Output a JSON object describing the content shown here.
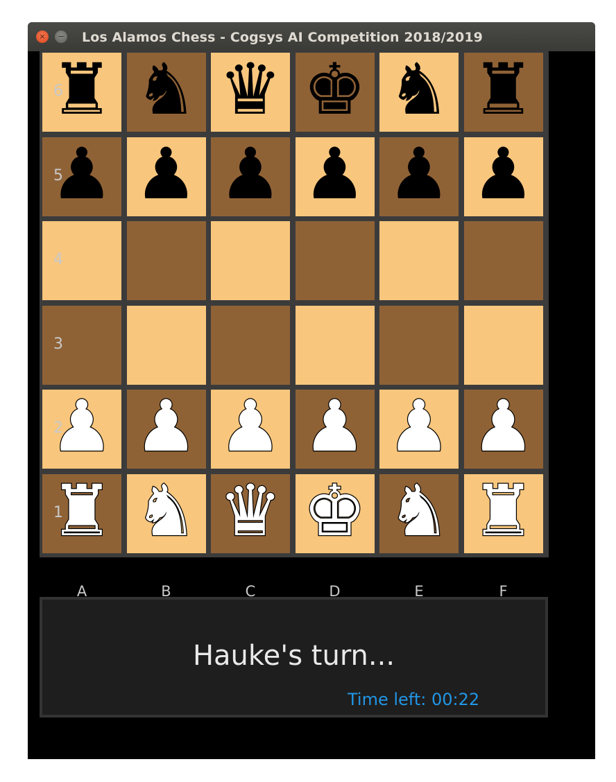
{
  "window": {
    "title": "Los Alamos Chess - Cogsys AI Competition 2018/2019",
    "close_glyph": "×",
    "minimize_glyph": "−"
  },
  "board": {
    "files": [
      "A",
      "B",
      "C",
      "D",
      "E",
      "F"
    ],
    "ranks": [
      "6",
      "5",
      "4",
      "3",
      "2",
      "1"
    ],
    "colors": {
      "light": "#f8c67d",
      "dark": "#8f6236",
      "grid": "#3b3b3b"
    },
    "rows": [
      [
        {
          "sq": "a6",
          "color": "light",
          "piece": "black-rook",
          "glyph": "♜",
          "side": "black"
        },
        {
          "sq": "b6",
          "color": "dark",
          "piece": "black-knight",
          "glyph": "♞",
          "side": "black"
        },
        {
          "sq": "c6",
          "color": "light",
          "piece": "black-queen",
          "glyph": "♛",
          "side": "black"
        },
        {
          "sq": "d6",
          "color": "dark",
          "piece": "black-king",
          "glyph": "♚",
          "side": "black"
        },
        {
          "sq": "e6",
          "color": "light",
          "piece": "black-knight",
          "glyph": "♞",
          "side": "black"
        },
        {
          "sq": "f6",
          "color": "dark",
          "piece": "black-rook",
          "glyph": "♜",
          "side": "black"
        }
      ],
      [
        {
          "sq": "a5",
          "color": "dark",
          "piece": "black-pawn",
          "glyph": "♟",
          "side": "black"
        },
        {
          "sq": "b5",
          "color": "light",
          "piece": "black-pawn",
          "glyph": "♟",
          "side": "black"
        },
        {
          "sq": "c5",
          "color": "dark",
          "piece": "black-pawn",
          "glyph": "♟",
          "side": "black"
        },
        {
          "sq": "d5",
          "color": "light",
          "piece": "black-pawn",
          "glyph": "♟",
          "side": "black"
        },
        {
          "sq": "e5",
          "color": "dark",
          "piece": "black-pawn",
          "glyph": "♟",
          "side": "black"
        },
        {
          "sq": "f5",
          "color": "light",
          "piece": "black-pawn",
          "glyph": "♟",
          "side": "black"
        }
      ],
      [
        {
          "sq": "a4",
          "color": "light",
          "piece": null
        },
        {
          "sq": "b4",
          "color": "dark",
          "piece": null
        },
        {
          "sq": "c4",
          "color": "light",
          "piece": null
        },
        {
          "sq": "d4",
          "color": "dark",
          "piece": null
        },
        {
          "sq": "e4",
          "color": "light",
          "piece": null
        },
        {
          "sq": "f4",
          "color": "dark",
          "piece": null
        }
      ],
      [
        {
          "sq": "a3",
          "color": "dark",
          "piece": null
        },
        {
          "sq": "b3",
          "color": "light",
          "piece": null
        },
        {
          "sq": "c3",
          "color": "dark",
          "piece": null
        },
        {
          "sq": "d3",
          "color": "light",
          "piece": null
        },
        {
          "sq": "e3",
          "color": "dark",
          "piece": null
        },
        {
          "sq": "f3",
          "color": "light",
          "piece": null
        }
      ],
      [
        {
          "sq": "a2",
          "color": "light",
          "piece": "white-pawn",
          "glyph": "♟",
          "side": "white"
        },
        {
          "sq": "b2",
          "color": "dark",
          "piece": "white-pawn",
          "glyph": "♟",
          "side": "white"
        },
        {
          "sq": "c2",
          "color": "light",
          "piece": "white-pawn",
          "glyph": "♟",
          "side": "white"
        },
        {
          "sq": "d2",
          "color": "dark",
          "piece": "white-pawn",
          "glyph": "♟",
          "side": "white"
        },
        {
          "sq": "e2",
          "color": "light",
          "piece": "white-pawn",
          "glyph": "♟",
          "side": "white"
        },
        {
          "sq": "f2",
          "color": "dark",
          "piece": "white-pawn",
          "glyph": "♟",
          "side": "white"
        }
      ],
      [
        {
          "sq": "a1",
          "color": "dark",
          "piece": "white-rook",
          "glyph": "♜",
          "side": "white"
        },
        {
          "sq": "b1",
          "color": "light",
          "piece": "white-knight",
          "glyph": "♞",
          "side": "white"
        },
        {
          "sq": "c1",
          "color": "dark",
          "piece": "white-queen",
          "glyph": "♛",
          "side": "white"
        },
        {
          "sq": "d1",
          "color": "light",
          "piece": "white-king",
          "glyph": "♚",
          "side": "white"
        },
        {
          "sq": "e1",
          "color": "dark",
          "piece": "white-knight",
          "glyph": "♞",
          "side": "white"
        },
        {
          "sq": "f1",
          "color": "light",
          "piece": "white-rook",
          "glyph": "♜",
          "side": "white"
        }
      ]
    ]
  },
  "status": {
    "message": "Hauke's turn...",
    "timer": "Time left: 00:22",
    "timer_color": "#2196e6"
  }
}
